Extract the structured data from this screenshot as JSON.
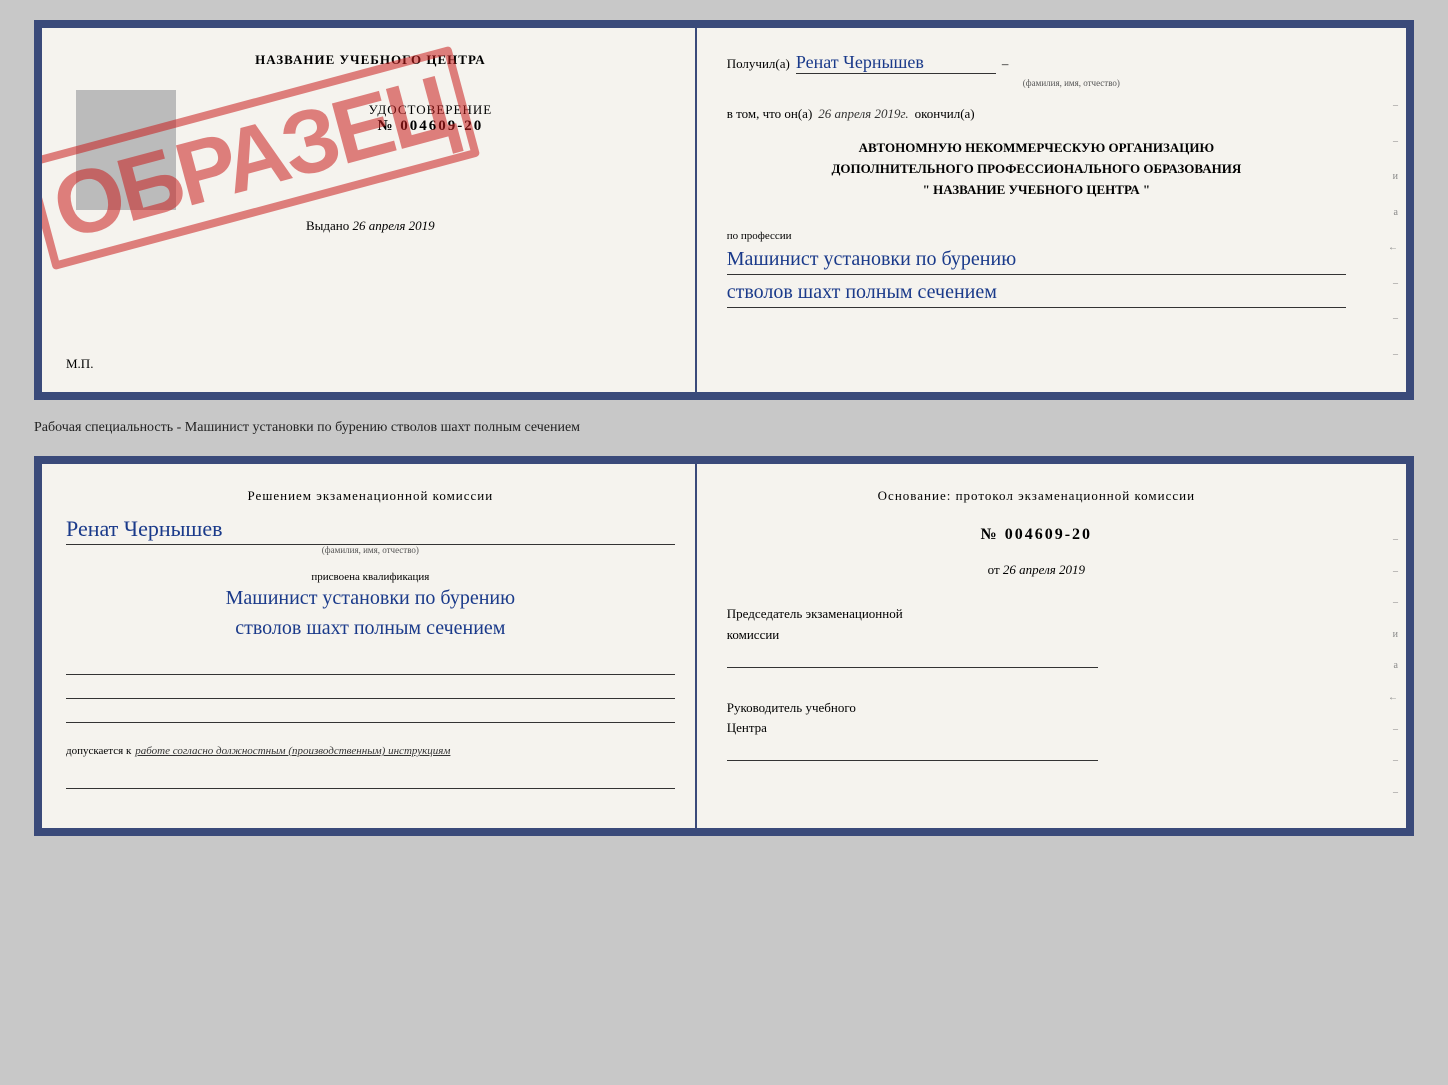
{
  "top_cert": {
    "left": {
      "title": "НАЗВАНИЕ УЧЕБНОГО ЦЕНТРА",
      "stamp": "ОБРАЗЕЦ",
      "udostoverenie_label": "УДОСТОВЕРЕНИЕ",
      "number": "№ 004609-20",
      "issued_label": "Выдано",
      "issued_date": "26 апреля 2019",
      "mp_label": "М.П."
    },
    "right": {
      "received_label": "Получил(а)",
      "recipient_name": "Ренат Чернышев",
      "recipient_subtext": "(фамилия, имя, отчество)",
      "in_that_label": "в том, что он(а)",
      "completion_date": "26 апреля 2019г.",
      "finished_label": "окончил(а)",
      "org_line1": "АВТОНОМНУЮ НЕКОММЕРЧЕСКУЮ ОРГАНИЗАЦИЮ",
      "org_line2": "ДОПОЛНИТЕЛЬНОГО ПРОФЕССИОНАЛЬНОГО ОБРАЗОВАНИЯ",
      "org_line3": "\"  НАЗВАНИЕ УЧЕБНОГО ЦЕНТРА  \"",
      "profession_label": "по профессии",
      "profession_line1": "Машинист установки по бурению",
      "profession_line2": "стволов шахт полным сечением",
      "edge_chars": [
        "–",
        "–",
        "и",
        "а",
        "←",
        "–",
        "–",
        "–"
      ]
    }
  },
  "specialty_line": {
    "text": "Рабочая специальность - Машинист установки по бурению стволов шахт полным сечением"
  },
  "bottom_cert": {
    "left": {
      "komissia_title": "Решением экзаменационной комиссии",
      "name": "Ренат Чернышев",
      "name_subtext": "(фамилия, имя, отчество)",
      "kvalif_label": "присвоена квалификация",
      "kvalif_line1": "Машинист установки по бурению",
      "kvalif_line2": "стволов шахт полным сечением",
      "dopusk_label": "допускается к",
      "dopusk_text": "работе согласно должностным (производственным) инструкциям"
    },
    "right": {
      "osnov_label": "Основание: протокол экзаменационной комиссии",
      "protokol_number": "№  004609-20",
      "date_prefix": "от",
      "protokol_date": "26 апреля 2019",
      "chairman_label": "Председатель экзаменационной",
      "chairman_label2": "комиссии",
      "head_label": "Руководитель учебного",
      "head_label2": "Центра",
      "edge_chars": [
        "–",
        "–",
        "–",
        "и",
        "а",
        "←",
        "–",
        "–",
        "–"
      ]
    }
  }
}
